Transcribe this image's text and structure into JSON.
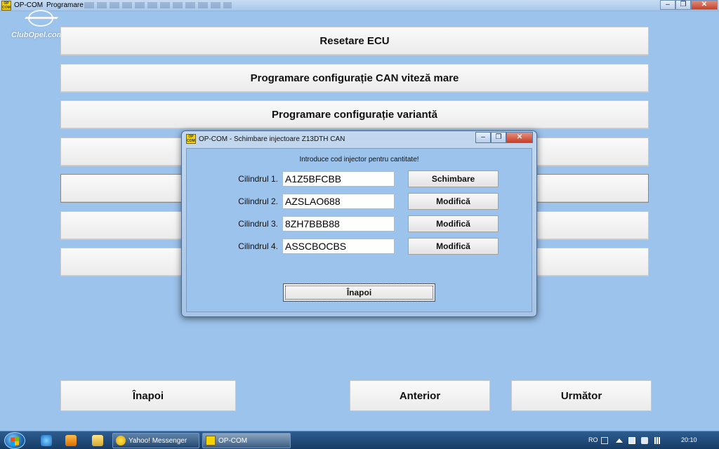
{
  "window": {
    "logo_text": "OP COM",
    "title": "OP-COM",
    "menu_label": "Programare",
    "min_icon": "minimize-icon",
    "max_icon": "maximize-icon",
    "close_icon": "close-icon"
  },
  "watermark": {
    "text": "ClubOpel.com"
  },
  "menu": {
    "items": [
      "Resetare ECU",
      "Programare configurație CAN viteză mare",
      "Programare configurație variantă",
      "",
      "",
      "",
      ""
    ]
  },
  "nav": {
    "back": "Înapoi",
    "previous": "Anterior",
    "next": "Următor"
  },
  "dialog": {
    "title": "OP-COM - Schimbare injectoare Z13DTH CAN",
    "prompt": "Introduce cod injector pentru cantitate!",
    "rows": [
      {
        "label": "Cilindrul 1.",
        "code": "A1Z5BFCBB",
        "action": "Schimbare"
      },
      {
        "label": "Cilindrul 2.",
        "code": "AZSLAO688",
        "action": "Modifică"
      },
      {
        "label": "Cilindrul 3.",
        "code": "8ZH7BBB88",
        "action": "Modifică"
      },
      {
        "label": "Cilindrul 4.",
        "code": "ASSCBOCBS",
        "action": "Modifică"
      }
    ],
    "back": "Înapoi"
  },
  "taskbar": {
    "tasks": [
      {
        "label": "Yahoo! Messenger",
        "icon": "yahoo-messenger-icon"
      },
      {
        "label": "OP-COM",
        "icon": "opcom-app-icon"
      }
    ],
    "language": "RO",
    "clock": "20:10"
  },
  "colors": {
    "background": "#9cc3ec",
    "button": "#f2f2f2",
    "taskbar": "#1f4a7a"
  }
}
